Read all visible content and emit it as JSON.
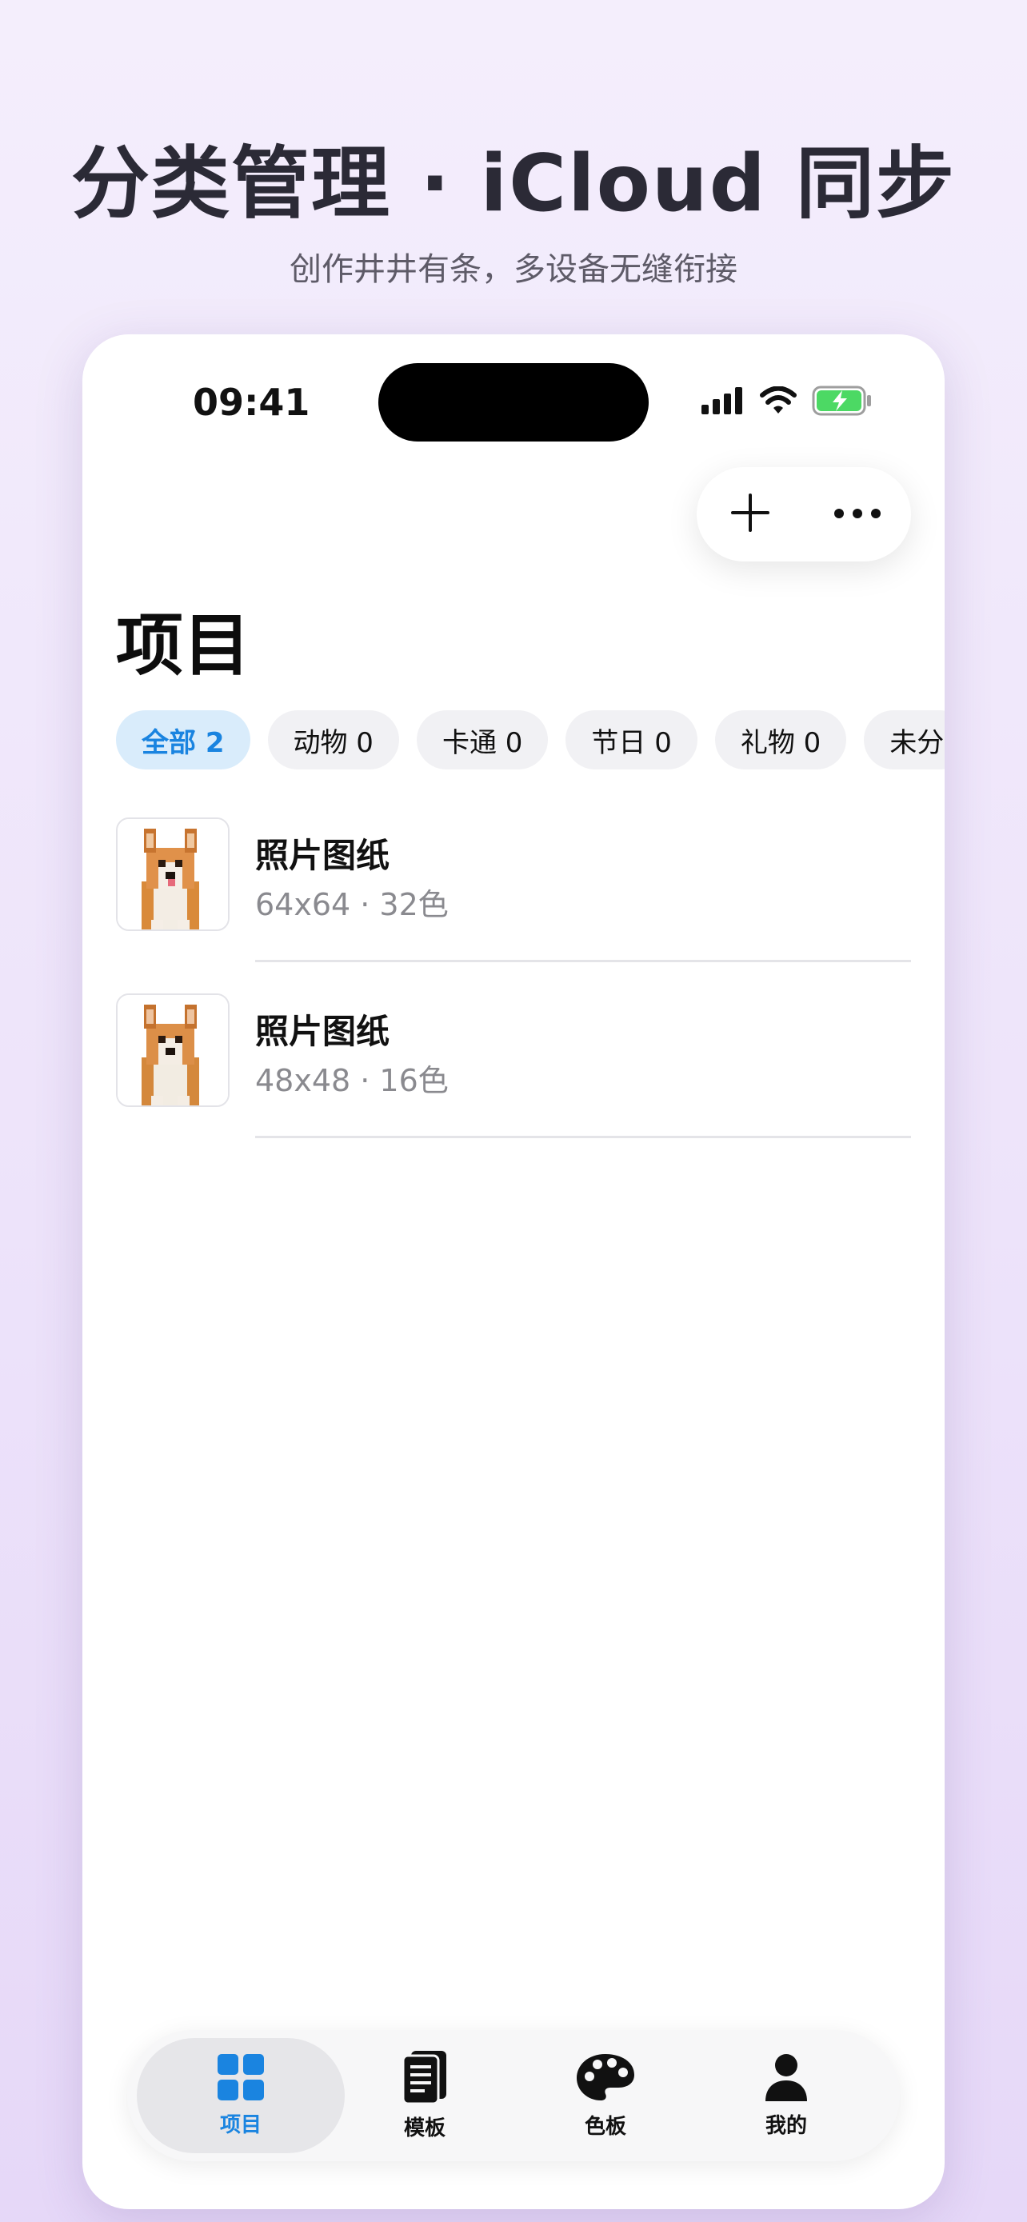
{
  "promo": {
    "headline": "分类管理 · iCloud 同步",
    "subline": "创作井井有条，多设备无缝衔接"
  },
  "status_bar": {
    "time": "09:41",
    "icons": [
      "cellular-signal-icon",
      "wifi-icon",
      "battery-charging-icon"
    ]
  },
  "toolbar": {
    "add_icon": "plus-icon",
    "more_icon": "ellipsis-icon"
  },
  "page": {
    "title": "项目"
  },
  "filters": [
    {
      "label": "全部 2",
      "active": true
    },
    {
      "label": "动物 0",
      "active": false
    },
    {
      "label": "卡通 0",
      "active": false
    },
    {
      "label": "节日 0",
      "active": false
    },
    {
      "label": "礼物 0",
      "active": false
    },
    {
      "label": "未分",
      "active": false
    }
  ],
  "projects": [
    {
      "title": "照片图纸",
      "subtitle": "64x64 · 32色",
      "thumbnail": "corgi-pixel-image"
    },
    {
      "title": "照片图纸",
      "subtitle": "48x48 · 16色",
      "thumbnail": "corgi-pixel-image"
    }
  ],
  "tabbar": [
    {
      "label": "项目",
      "icon": "grid-icon",
      "active": true
    },
    {
      "label": "模板",
      "icon": "document-icon",
      "active": false
    },
    {
      "label": "色板",
      "icon": "palette-icon",
      "active": false
    },
    {
      "label": "我的",
      "icon": "person-icon",
      "active": false
    }
  ],
  "colors": {
    "accent": "#1a84e0",
    "chip_active_bg": "#d9ecfb",
    "battery": "#4cd964"
  }
}
